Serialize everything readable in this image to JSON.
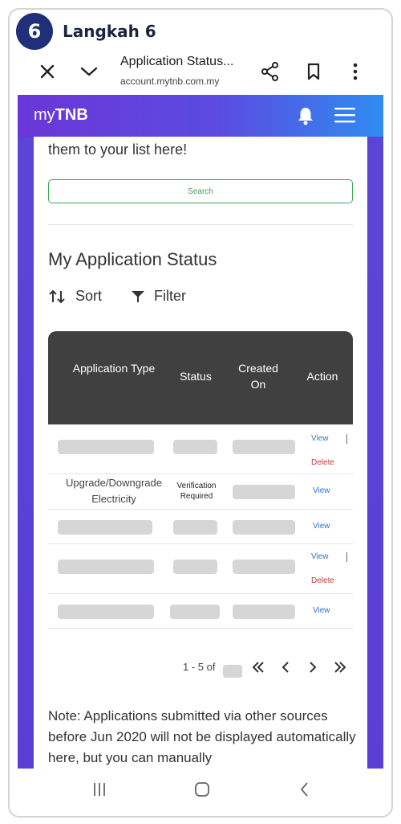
{
  "step": {
    "number": "6",
    "title": "Langkah 6"
  },
  "browser": {
    "page_title": "Application Status...",
    "domain": "account.mytnb.com.my",
    "icons": [
      "close-icon",
      "chevron-down-icon",
      "share-icon",
      "bookmark-icon",
      "more-vert-icon"
    ]
  },
  "site": {
    "logo_prefix": "my",
    "logo_suffix": "TNB",
    "intro_text": "them to your list here!",
    "search_label": "Search",
    "section_title": "My Application Status",
    "sort_label": "Sort",
    "filter_label": "Filter",
    "table": {
      "headers": [
        "Application Type",
        "Status",
        "Created On",
        "Action"
      ],
      "rows": [
        {
          "type": "",
          "status": "",
          "created": "",
          "actions": [
            "View",
            "Delete"
          ]
        },
        {
          "type": "Upgrade/Downgrade Electricity",
          "status": "Verification Required",
          "created": "",
          "actions": [
            "View"
          ]
        },
        {
          "type": "",
          "status": "",
          "created": "",
          "actions": [
            "View"
          ]
        },
        {
          "type": "",
          "status": "",
          "created": "",
          "actions": [
            "View",
            "Delete"
          ]
        },
        {
          "type": "",
          "status": "",
          "created": "",
          "actions": [
            "View"
          ]
        }
      ]
    },
    "pagination": {
      "range_text": "1 - 5 of"
    },
    "note": "Note: Applications submitted via other sources before Jun 2020 will not be displayed automatically here, but you can manually"
  },
  "colors": {
    "brand_purple": "#5b45d6",
    "header_gradient_end": "#2f8cf2",
    "table_header": "#404040",
    "link": "#2d73c8",
    "delete": "#c43b3b",
    "search_border": "#3aaa55",
    "step_badge": "#1f2f7a"
  }
}
